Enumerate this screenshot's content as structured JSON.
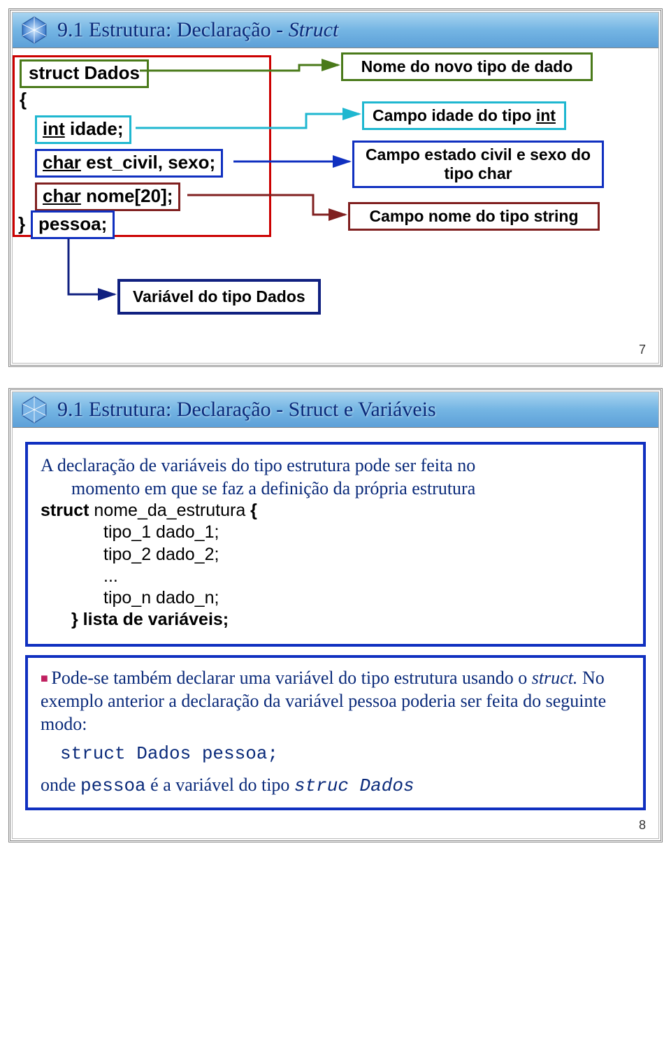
{
  "slide1": {
    "title_prefix": "9.1 Estrutura: Declaração - ",
    "title_italic": "Struct",
    "code": {
      "struct_line": "struct Dados",
      "brace_open": "{",
      "idade_pre": "int",
      "idade_post": " idade;",
      "est_pre": "char",
      "est_post": " est_civil, sexo;",
      "nome_pre": "char",
      "nome_post": " nome[20];",
      "pessoa_pre": "} ",
      "pessoa": "pessoa;"
    },
    "labels": {
      "novo_tipo": "Nome do novo tipo de dado",
      "campo_idade_pre": "Campo idade do tipo ",
      "campo_idade_u": "int",
      "campo_estado": "Campo estado civil e sexo do tipo char",
      "campo_nome": "Campo nome do tipo string",
      "variavel": "Variável do tipo Dados"
    },
    "page": "7"
  },
  "slide2": {
    "title": "9.1 Estrutura: Declaração - Struct e Variáveis",
    "para1_a": "A declaração de variáveis do tipo estrutura pode ser feita no",
    "para1_b": "momento em que se faz a definição da própria estrutura",
    "code": {
      "l1_pre": "struct",
      "l1_mid": " nome_da_estrutura ",
      "l1_post": "{",
      "l2": "tipo_1 dado_1;",
      "l3": "tipo_2 dado_2;",
      "l4": "...",
      "l5": "tipo_n dado_n;",
      "l6": "} lista de variáveis;"
    },
    "para2_a": "Pode-se também declarar uma variável do tipo estrutura usando o ",
    "para2_it": "struct.",
    "para2_b": " No exemplo anterior a declaração da variável pessoa poderia ser feita do seguinte modo:",
    "code2": "struct Dados pessoa;",
    "para3_a": "onde ",
    "para3_m1": "pessoa",
    "para3_b": " é a variável do tipo ",
    "para3_m2": "struc Dados",
    "page": "8"
  }
}
